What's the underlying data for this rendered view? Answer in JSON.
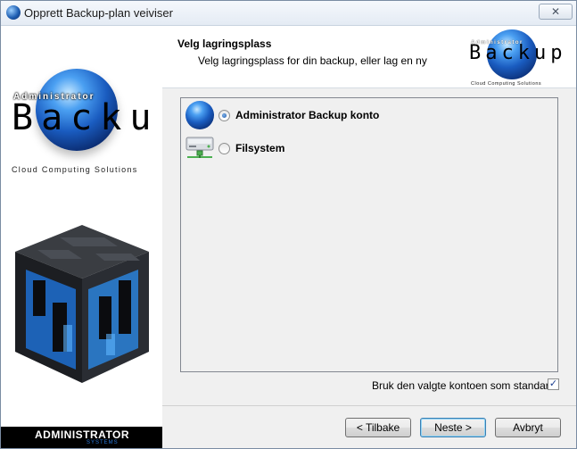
{
  "window": {
    "title": "Opprett Backup-plan veiviser",
    "close_glyph": "✕"
  },
  "branding": {
    "admin_text": "Administrator",
    "backup_text": "Backup",
    "tagline": "Cloud Computing Solutions",
    "company": "ADMINISTRATOR",
    "company_sub": "SYSTEMS"
  },
  "header": {
    "title": "Velg lagringsplass",
    "subtitle": "Velg lagringsplass for din backup, eller lag en ny"
  },
  "options": [
    {
      "label": "Administrator Backup konto",
      "icon": "globe-icon",
      "selected": true
    },
    {
      "label": "Filsystem",
      "icon": "drive-icon",
      "selected": false
    }
  ],
  "default_checkbox": {
    "label": "Bruk den valgte kontoen som standard",
    "checked": true,
    "check_glyph": "✓"
  },
  "buttons": {
    "back": "< Tilbake",
    "next": "Neste >",
    "cancel": "Avbryt"
  },
  "colors": {
    "accent_blue": "#1a5cc0",
    "dialog_bg": "#f0f0f0"
  }
}
